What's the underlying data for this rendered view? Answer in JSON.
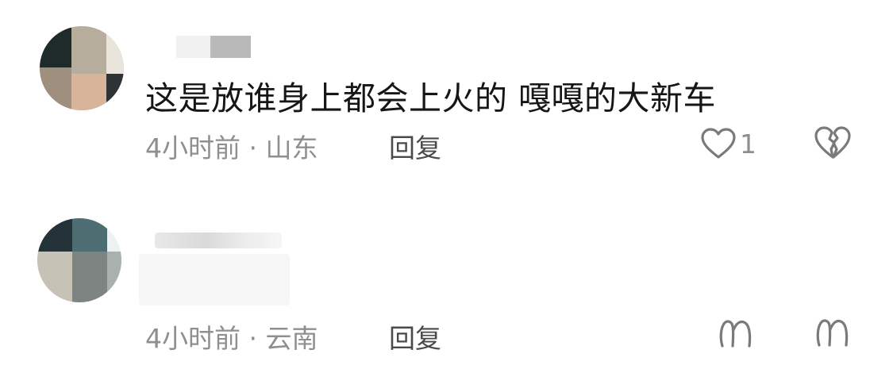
{
  "comments": [
    {
      "text": "这是放谁身上都会上火的  嘎嘎的大新车",
      "time": "4小时前",
      "separator": "·",
      "location": "山东",
      "reply_label": "回复",
      "like_count": "1",
      "like_icon": "heart-outline-icon",
      "dislike_icon": "broken-heart-icon"
    },
    {
      "time": "4小时前",
      "separator": "·",
      "location": "云南",
      "reply_label": "回复",
      "like_icon": "heart-outline-icon",
      "dislike_icon": "broken-heart-icon"
    }
  ],
  "colors": {
    "text_primary": "#161616",
    "text_secondary": "#8f8f8f",
    "reply": "#4a4a4a",
    "icon": "#7a7a7a"
  }
}
